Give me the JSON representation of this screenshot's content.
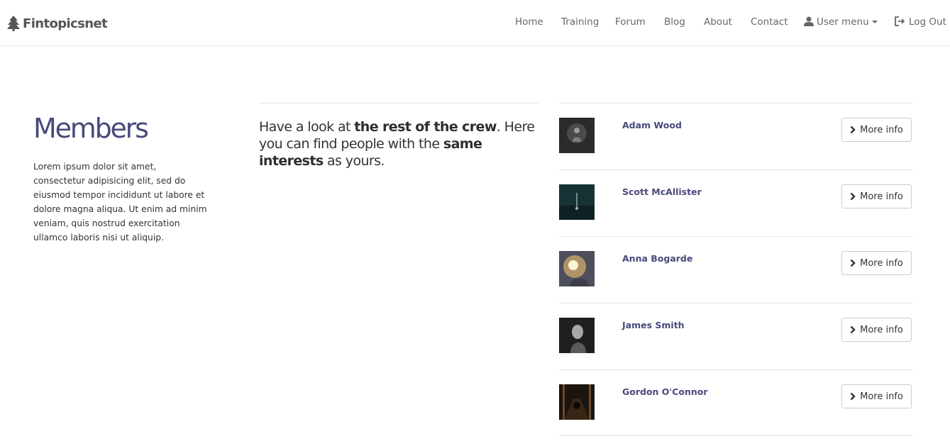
{
  "brand": {
    "name": "Fintopicsnet",
    "icon": "tree-icon"
  },
  "nav": {
    "items": [
      {
        "label": "Home"
      },
      {
        "label": "Training"
      },
      {
        "label": "Forum"
      },
      {
        "label": "Blog"
      },
      {
        "label": "About"
      },
      {
        "label": "Contact"
      }
    ],
    "user_menu": {
      "label": "User menu",
      "icon": "user-icon"
    },
    "logout": {
      "label": "Log Out",
      "icon": "logout-icon"
    }
  },
  "left": {
    "title": "Members",
    "body": "Lorem ipsum dolor sit amet, consectetur adipisicing elit, sed do eiusmod tempor incididunt ut labore et dolore magna aliqua. Ut enim ad minim veniam, quis nostrud exercitation ullamco laboris nisi ut aliquip."
  },
  "middle": {
    "lead_1": "Have a look at ",
    "lead_2": "the rest of the crew",
    "lead_3": ". Here you can find people with the ",
    "lead_4": "same interests",
    "lead_5": " as yours."
  },
  "members": [
    {
      "name": "Adam Wood",
      "button": "More info"
    },
    {
      "name": "Scott McAllister",
      "button": "More info"
    },
    {
      "name": "Anna Bogarde",
      "button": "More info"
    },
    {
      "name": "James Smith",
      "button": "More info"
    },
    {
      "name": "Gordon O'Connor",
      "button": "More info"
    }
  ],
  "colors": {
    "accent": "#474a7a",
    "text": "#333333",
    "nav_text": "#666666",
    "border": "#e6e6e6"
  }
}
